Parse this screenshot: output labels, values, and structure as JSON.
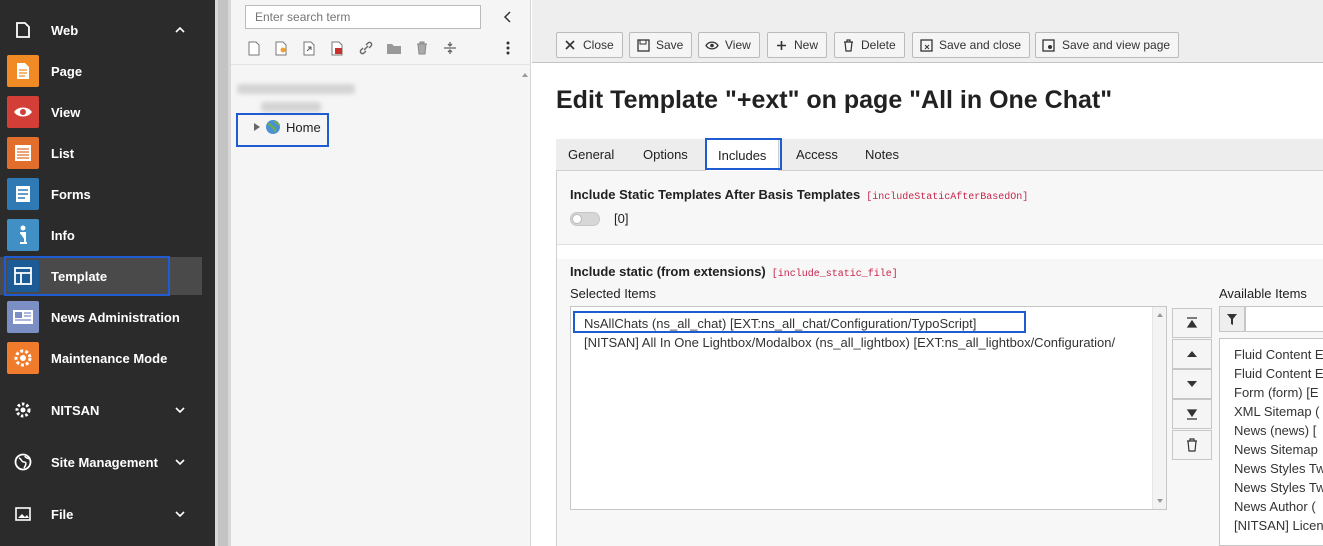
{
  "sidebar": {
    "items": [
      {
        "label": "Web",
        "icon": "file-icon"
      },
      {
        "label": "Page",
        "icon": "page-module-icon",
        "color": "#f08a24"
      },
      {
        "label": "View",
        "icon": "eye-icon",
        "color": "#d33f36"
      },
      {
        "label": "List",
        "icon": "list-icon",
        "color": "#e16e2b"
      },
      {
        "label": "Forms",
        "icon": "forms-icon",
        "color": "#2f7ab5"
      },
      {
        "label": "Info",
        "icon": "info-icon",
        "color": "#4190c5"
      },
      {
        "label": "Template",
        "icon": "template-icon",
        "color": "#1d5b96"
      },
      {
        "label": "News Administration",
        "icon": "news-icon",
        "color": "#7c8fc4"
      },
      {
        "label": "Maintenance Mode",
        "icon": "gear-badge-icon",
        "color": "#f07b2c"
      },
      {
        "label": "NITSAN",
        "icon": "gear-icon"
      },
      {
        "label": "Site Management",
        "icon": "globe-icon"
      },
      {
        "label": "File",
        "icon": "image-icon"
      }
    ]
  },
  "tree": {
    "search_placeholder": "Enter search term",
    "home_label": "Home"
  },
  "toolbar": {
    "close": "Close",
    "save": "Save",
    "view": "View",
    "new": "New",
    "delete": "Delete",
    "save_close": "Save and close",
    "save_view": "Save and view page"
  },
  "page_title": "Edit Template \"+ext\" on page \"All in One Chat\"",
  "tabs": [
    "General",
    "Options",
    "Includes",
    "Access",
    "Notes"
  ],
  "fields": {
    "static_after_label": "Include Static Templates After Basis Templates",
    "static_after_code": "[includeStaticAfterBasedOn]",
    "static_after_value": "[0]",
    "include_static_label": "Include static (from extensions)",
    "include_static_code": "[include_static_file]",
    "selected_label": "Selected Items",
    "available_label": "Available Items",
    "selected_items": [
      "NsAllChats (ns_all_chat) [EXT:ns_all_chat/Configuration/TypoScript]",
      "[NITSAN] All In One Lightbox/Modalbox (ns_all_lightbox) [EXT:ns_all_lightbox/Configuration/"
    ],
    "available_items": [
      "Fluid Content E",
      "Fluid Content E",
      "Form (form) [E",
      "XML Sitemap (",
      "News (news) [",
      "News Sitemap",
      "News Styles Tw",
      "News Styles Tw",
      "News Author (",
      "[NITSAN] Licen"
    ]
  },
  "colors": {
    "sidebar_bg": "#2b2b2b",
    "highlight": "#1f5cd1",
    "code_text": "#c7254e"
  }
}
